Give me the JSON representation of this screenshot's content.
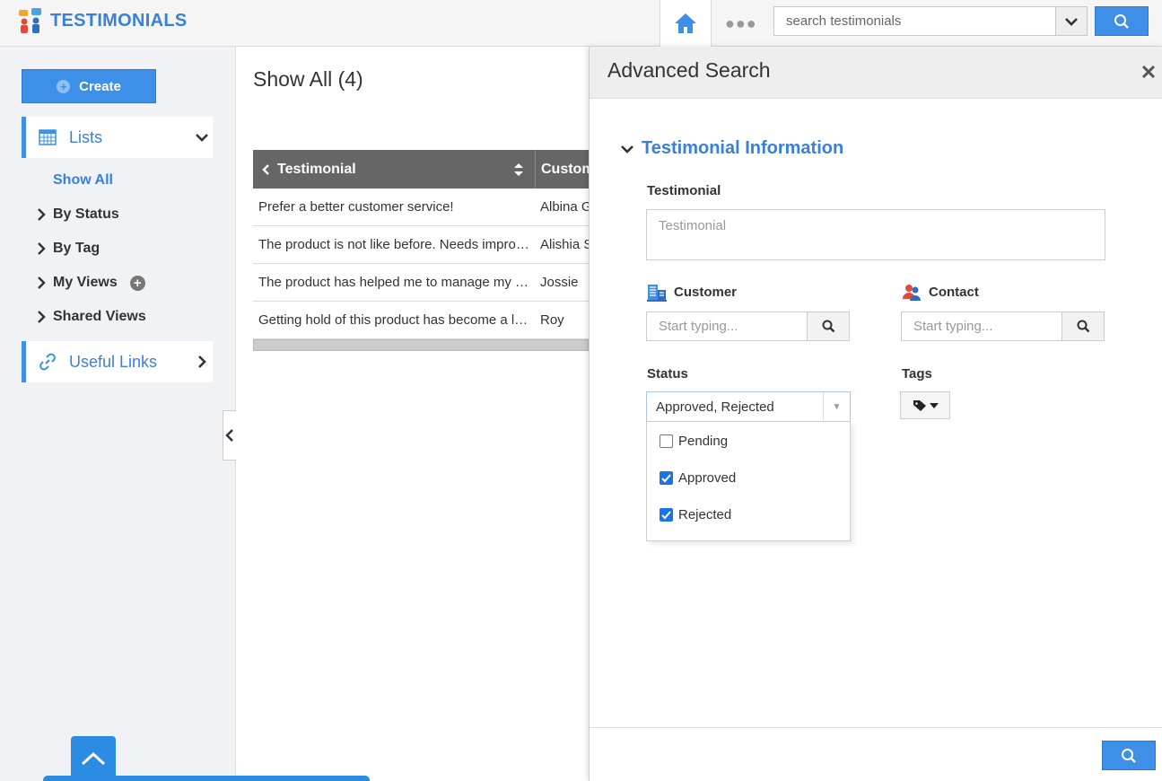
{
  "header": {
    "app_title": "TESTIMONIALS",
    "more_label": "●●●",
    "search_placeholder": "search testimonials"
  },
  "sidebar": {
    "create_label": "Create",
    "lists_label": "Lists",
    "show_all_label": "Show All",
    "items": [
      {
        "label": "By Status"
      },
      {
        "label": "By Tag"
      },
      {
        "label": "My Views"
      },
      {
        "label": "Shared Views"
      }
    ],
    "useful_links_label": "Useful Links"
  },
  "main": {
    "title": "Show All (4)",
    "columns": [
      "Testimonial",
      "Customer"
    ],
    "rows": [
      {
        "testimonial": "Prefer a better customer service!",
        "customer": "Albina G"
      },
      {
        "testimonial": "The product is not like before. Needs improvement",
        "customer": "Alishia S"
      },
      {
        "testimonial": "The product has helped me to manage my business",
        "customer": "Jossie"
      },
      {
        "testimonial": "Getting hold of this product has become a lifesaver",
        "customer": "Roy"
      }
    ]
  },
  "advanced_search": {
    "title": "Advanced Search",
    "section_title": "Testimonial Information",
    "testimonial_label": "Testimonial",
    "testimonial_placeholder": "Testimonial",
    "customer_label": "Customer",
    "customer_placeholder": "Start typing...",
    "contact_label": "Contact",
    "contact_placeholder": "Start typing...",
    "status_label": "Status",
    "status_value": "Approved, Rejected",
    "status_options": [
      {
        "label": "Pending",
        "checked": false
      },
      {
        "label": "Approved",
        "checked": true
      },
      {
        "label": "Rejected",
        "checked": true
      }
    ],
    "tags_label": "Tags"
  },
  "colors": {
    "accent": "#3d8fe8",
    "link": "#3a7fd9",
    "grid_header": "#666666"
  }
}
